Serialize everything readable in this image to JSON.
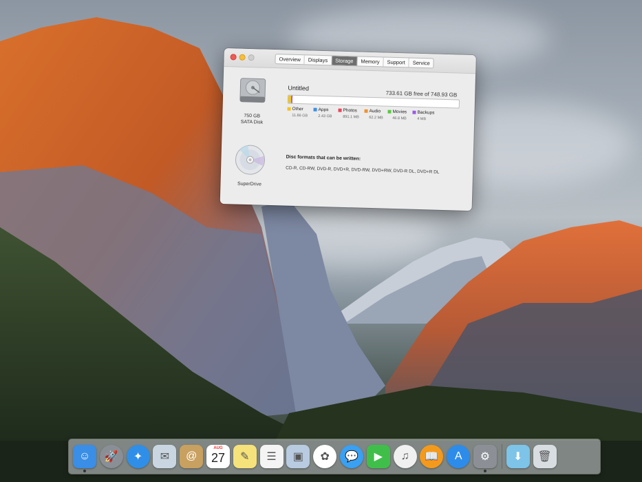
{
  "window": {
    "tabs": [
      {
        "label": "Overview",
        "active": false
      },
      {
        "label": "Displays",
        "active": false
      },
      {
        "label": "Storage",
        "active": true
      },
      {
        "label": "Memory",
        "active": false
      },
      {
        "label": "Support",
        "active": false
      },
      {
        "label": "Service",
        "active": false
      }
    ],
    "disk": {
      "capacity_label": "750 GB",
      "type_label": "SATA Disk",
      "name": "Untitled",
      "free_text": "733.61 GB free of 748.93 GB",
      "used_fraction": 0.0204,
      "categories": [
        {
          "label": "Other",
          "size": "11.86 GB",
          "color": "#f4c31f"
        },
        {
          "label": "Apps",
          "size": "2.43 GB",
          "color": "#3b8ee6"
        },
        {
          "label": "Photos",
          "size": "891.1 MB",
          "color": "#e8465a"
        },
        {
          "label": "Audio",
          "size": "62.2 MB",
          "color": "#f2922a"
        },
        {
          "label": "Movies",
          "size": "46.8 MB",
          "color": "#5cc742"
        },
        {
          "label": "Backups",
          "size": "4 MB",
          "color": "#9b59e6"
        }
      ]
    },
    "drive": {
      "name": "SuperDrive",
      "formats_title": "Disc formats that can be written:",
      "formats": "CD-R, CD-RW, DVD-R, DVD+R, DVD-RW, DVD+RW, DVD-R DL, DVD+R DL"
    }
  },
  "dock": {
    "calendar": {
      "month": "AUG",
      "day": "27"
    },
    "apps": [
      {
        "name": "finder-icon",
        "color": "#3a8ee6",
        "running": true
      },
      {
        "name": "launchpad-icon",
        "color": "#8a8f96",
        "running": false
      },
      {
        "name": "safari-icon",
        "color": "#2f8fe8",
        "running": false
      },
      {
        "name": "mail-icon",
        "color": "#c9d6e2",
        "running": false
      },
      {
        "name": "contacts-icon",
        "color": "#c8a060",
        "running": false
      },
      {
        "name": "calendar-icon",
        "color": "#ffffff",
        "running": false
      },
      {
        "name": "notes-icon",
        "color": "#f5e27a",
        "running": false
      },
      {
        "name": "reminders-icon",
        "color": "#f4f4f4",
        "running": false
      },
      {
        "name": "preview-icon",
        "color": "#b8cbe0",
        "running": false
      },
      {
        "name": "photos-icon",
        "color": "#ffffff",
        "running": false
      },
      {
        "name": "messages-icon",
        "color": "#3aa0f2",
        "running": false
      },
      {
        "name": "facetime-icon",
        "color": "#3fbf4a",
        "running": false
      },
      {
        "name": "itunes-icon",
        "color": "#f0f0f0",
        "running": false
      },
      {
        "name": "ibooks-icon",
        "color": "#f39a1d",
        "running": false
      },
      {
        "name": "app-store-icon",
        "color": "#2d8cea",
        "running": false
      },
      {
        "name": "system-preferences-icon",
        "color": "#8c9096",
        "running": true
      }
    ],
    "trailing": [
      {
        "name": "downloads-folder-icon",
        "color": "#7ec3e8"
      },
      {
        "name": "trash-icon",
        "color": "#d8dde2"
      }
    ]
  }
}
